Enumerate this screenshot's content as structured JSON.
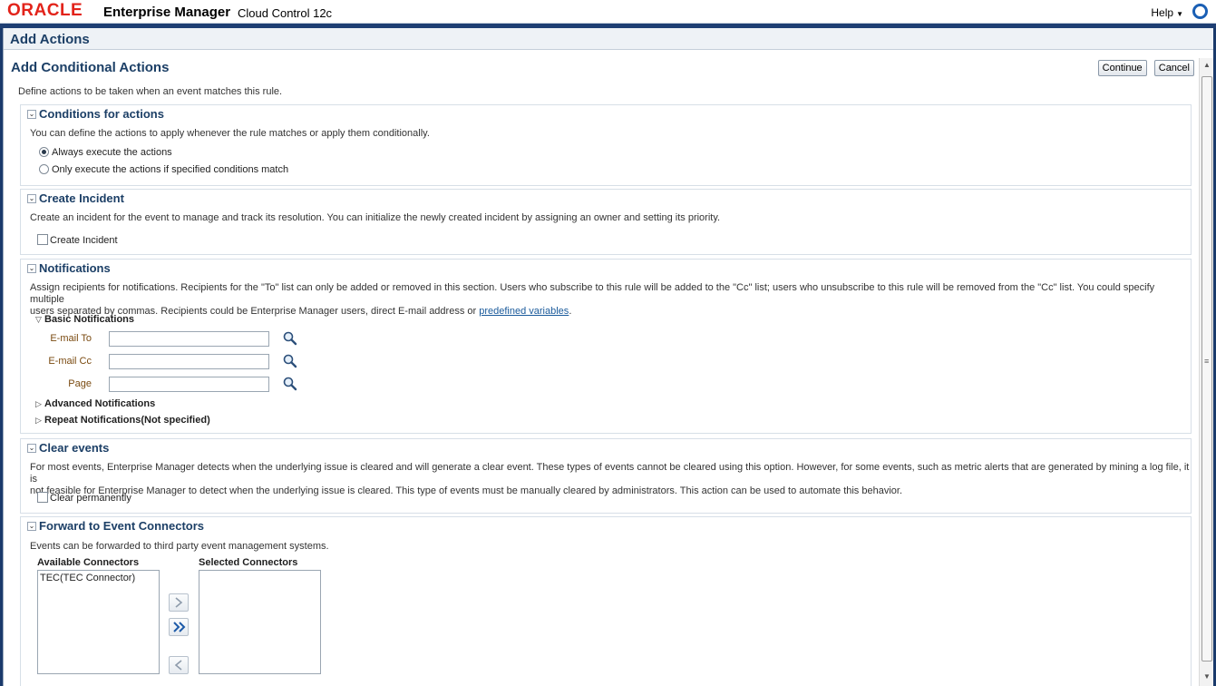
{
  "header": {
    "logo": "ORACLE",
    "product": "Enterprise Manager",
    "product_sub": "Cloud Control 12c",
    "help": "Help"
  },
  "page": {
    "title": "Add Actions",
    "subtitle": "Add Conditional Actions",
    "continue_label": "Continue",
    "cancel_label": "Cancel",
    "intro": "Define actions to be taken when an event matches this rule."
  },
  "conditions": {
    "title": "Conditions for actions",
    "desc": "You can define the actions to apply whenever the rule matches or apply them conditionally.",
    "options": [
      {
        "label": "Always execute the actions",
        "checked": true
      },
      {
        "label": "Only execute the actions if specified conditions match",
        "checked": false
      }
    ]
  },
  "incident": {
    "title": "Create Incident",
    "desc": "Create an incident for the event to manage and track its resolution. You can initialize the newly created incident by assigning an owner and setting its priority.",
    "checkbox_label": "Create Incident"
  },
  "notifications": {
    "title": "Notifications",
    "desc_line1": "Assign recipients for notifications. Recipients for the \"To\" list can only be added or removed in this section. Users who subscribe to this rule will be added to the \"Cc\" list; users who unsubscribe to this rule will be removed from the \"Cc\" list. You could specify multiple",
    "desc_line2": "users separated by commas. Recipients could be Enterprise Manager users, direct E-mail address or",
    "desc_link": "predefined variables",
    "desc_end": ".",
    "basic_label": "Basic Notifications",
    "fields": [
      {
        "label": "E-mail To",
        "value": ""
      },
      {
        "label": "E-mail Cc",
        "value": ""
      },
      {
        "label": "Page",
        "value": ""
      }
    ],
    "advanced_label": "Advanced Notifications",
    "repeat_label": "Repeat Notifications(Not specified)"
  },
  "clear": {
    "title": "Clear events",
    "desc_line1": "For most events, Enterprise Manager detects when the underlying issue is cleared and will generate a clear event. These types of events cannot be cleared using this option. However, for some events, such as metric alerts that are generated by mining a log file, it is",
    "desc_line2": "not feasible for Enterprise Manager to detect when the underlying issue is cleared. This type of events must be manually cleared by administrators. This action can be used to automate this behavior.",
    "checkbox_label": "Clear permanently"
  },
  "connectors": {
    "title": "Forward to Event Connectors",
    "desc": "Events can be forwarded to third party event management systems.",
    "available_label": "Available Connectors",
    "selected_label": "Selected Connectors",
    "available_items": [
      "TEC(TEC Connector)"
    ],
    "selected_items": []
  },
  "icons": {
    "collapse": "collapse-icon",
    "search": "search-icon",
    "move": "move-right-icon",
    "move_all": "move-all-right-icon",
    "remove": "move-left-icon"
  },
  "colors": {
    "title": "#1c3f66",
    "logo_red": "#e2231a",
    "field_label": "#7a4a10",
    "link": "#1a5a9b"
  }
}
